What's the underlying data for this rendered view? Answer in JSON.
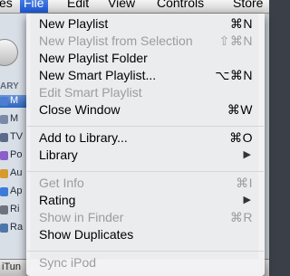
{
  "menubar": {
    "items": [
      "es",
      "File",
      "Edit",
      "View",
      "Controls",
      "Store"
    ]
  },
  "background": {
    "sidebar_header": "ARY",
    "sidebar_items": [
      "M",
      "M",
      "TV",
      "Po",
      "Au",
      "Ap",
      "Ri",
      "Ra"
    ],
    "status_text": "iTun"
  },
  "menu": {
    "items": [
      {
        "label": "New Playlist",
        "shortcut": "⌘N",
        "enabled": true
      },
      {
        "label": "New Playlist from Selection",
        "shortcut": "⇧⌘N",
        "enabled": false
      },
      {
        "label": "New Playlist Folder",
        "shortcut": "",
        "enabled": true
      },
      {
        "label": "New Smart Playlist...",
        "shortcut": "⌥⌘N",
        "enabled": true
      },
      {
        "label": "Edit Smart Playlist",
        "shortcut": "",
        "enabled": false
      },
      {
        "label": "Close Window",
        "shortcut": "⌘W",
        "enabled": true
      },
      {
        "label": "Add to Library...",
        "shortcut": "⌘O",
        "enabled": true
      },
      {
        "label": "Library",
        "shortcut": "",
        "enabled": true,
        "submenu": true
      },
      {
        "label": "Get Info",
        "shortcut": "⌘I",
        "enabled": false
      },
      {
        "label": "Rating",
        "shortcut": "",
        "enabled": true,
        "submenu": true
      },
      {
        "label": "Show in Finder",
        "shortcut": "⌘R",
        "enabled": false
      },
      {
        "label": "Show Duplicates",
        "shortcut": "",
        "enabled": true
      },
      {
        "label": "Sync iPod",
        "shortcut": "",
        "enabled": false
      }
    ],
    "submenu_arrow": "▶"
  },
  "colors": {
    "highlight": "#2a5fd1",
    "disabled_text": "#9c9c9c",
    "menu_bg": "#f3f3f5"
  }
}
